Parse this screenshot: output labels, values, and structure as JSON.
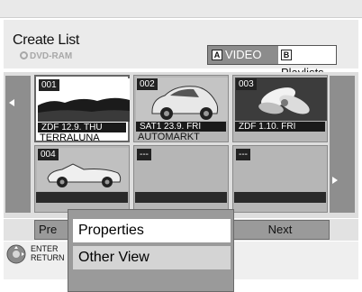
{
  "header": {
    "title": "Create List",
    "disc_label": "DVD-RAM",
    "tabs": [
      {
        "key": "A",
        "label": "VIDEO",
        "selected": true
      },
      {
        "key": "B",
        "label": "Playlists",
        "selected": false
      }
    ]
  },
  "grid": {
    "items": [
      {
        "number": "001",
        "info": "ZDF   12.9. THU",
        "name": "TERRALUNA",
        "thumbnail": "landscape-thumbnail",
        "selected": true
      },
      {
        "number": "002",
        "info": "SAT1   23.9. FRI",
        "name": "AUTOMARKT",
        "thumbnail": "car-thumbnail",
        "selected": false
      },
      {
        "number": "003",
        "info": "ZDF      1.10. FRI",
        "name": "",
        "thumbnail": "flower-thumbnail",
        "selected": false
      },
      {
        "number": "004",
        "info": "",
        "name": "",
        "thumbnail": "convertible-thumbnail",
        "selected": false
      },
      {
        "number": "---",
        "info": "",
        "name": "",
        "thumbnail": "",
        "selected": false
      },
      {
        "number": "---",
        "info": "",
        "name": "",
        "thumbnail": "",
        "selected": false
      }
    ]
  },
  "bottom": {
    "prev_label": "Pre",
    "next_label": "Next"
  },
  "help": {
    "line1": "ENTER",
    "line2": "RETURN"
  },
  "menu": {
    "items": [
      {
        "label": "Properties",
        "active": true
      },
      {
        "label": "Other View",
        "active": false
      }
    ]
  },
  "colors": {
    "panel": "#ebebeb",
    "nav": "#8e8e8e",
    "selected_tab": "#8c8c8c",
    "menu": "#9a9a9a"
  }
}
